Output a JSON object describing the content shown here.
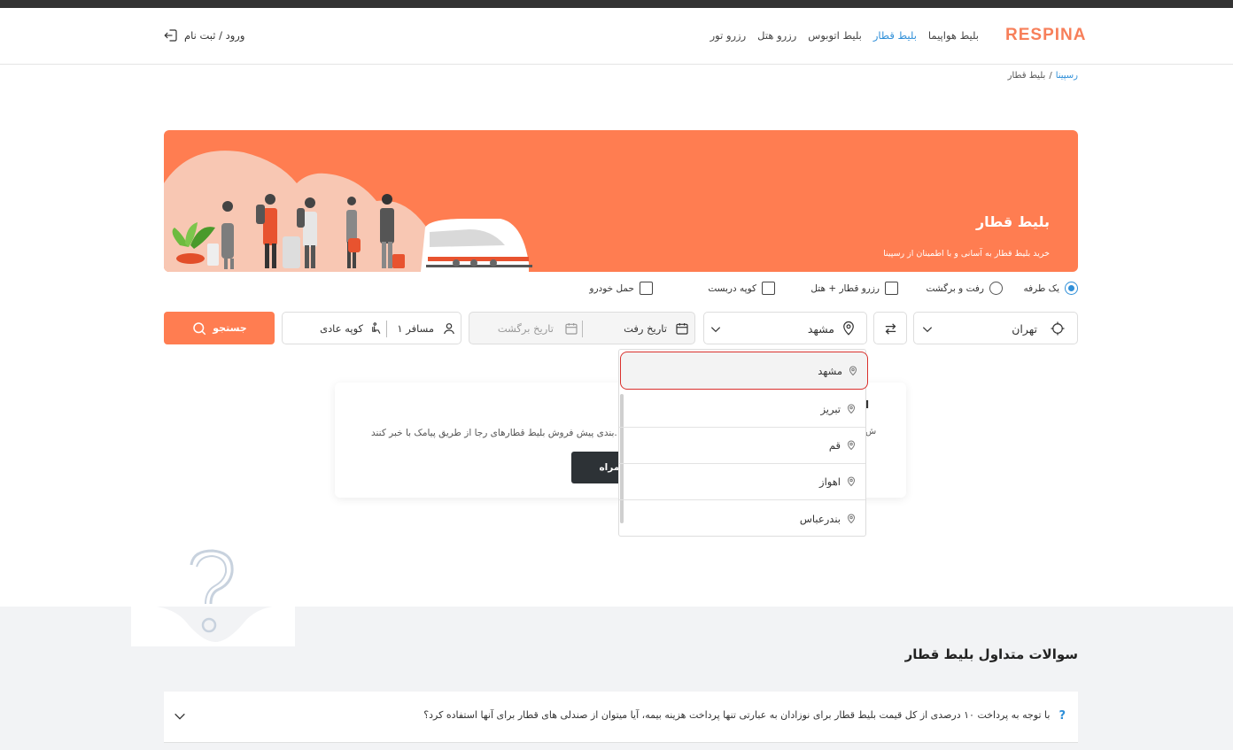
{
  "header": {
    "logo": "RESPINA",
    "nav": [
      {
        "label": "بلیط هواپیما",
        "active": false
      },
      {
        "label": "بلیط قطار",
        "active": true
      },
      {
        "label": "بلیط اتوبوس",
        "active": false
      },
      {
        "label": "رزرو هتل",
        "active": false
      },
      {
        "label": "رزرو تور",
        "active": false
      }
    ],
    "login_label": "ورود / ثبت نام",
    "accent": "#2f8fd8"
  },
  "breadcrumb": {
    "home": "رسپینا",
    "separator": "/",
    "current": "بلیط قطار"
  },
  "banner": {
    "title": "بلیط قطار",
    "subtitle": "خرید بلیط قطار به آسانی و با اطمینان از رسپینا",
    "bg_color": "#ff7d51"
  },
  "trip_options": {
    "one_way": "یک طرفه",
    "round_trip": "رفت و برگشت",
    "train_hotel": "رزرو قطار + هتل",
    "coupe": "کوپه دربست",
    "car_transport": "حمل خودرو",
    "selected": "one_way"
  },
  "search": {
    "origin": "تهران",
    "destination": "مشهد",
    "depart_date_placeholder": "تاریخ رفت",
    "return_date_placeholder": "تاریخ برگشت",
    "passengers": "۱ مسافر",
    "coupe_type": "کوپه عادی",
    "search_button": "جستجو",
    "button_color": "#ff7d51"
  },
  "destination_dropdown": {
    "items": [
      "مشهد",
      "تبریز",
      "قم",
      "اهواز",
      "بندرعباس"
    ],
    "selected_index": 0,
    "highlight_color": "#d9302c"
  },
  "notify_card": {
    "text": "بندی پیش فروش بلیط قطارهای رجا از طریق پیامک با خبر کنند.",
    "button_fragment": "ه همراه",
    "heading_fragment": "ا",
    "line_fragment": "ش"
  },
  "faq": {
    "title": "سوالات متداول بلیط قطار",
    "items": [
      {
        "icon": "?",
        "question": "با توجه به پرداخت ۱۰ درصدی از کل قیمت بلیط قطار برای نوزادان به عبارتی تنها پرداخت هزینه بیمه، آیا میتوان از صندلی های قطار برای آنها استفاده کرد؟"
      }
    ]
  }
}
